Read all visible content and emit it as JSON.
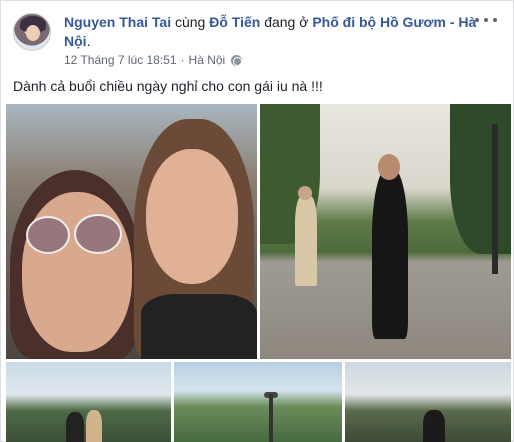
{
  "post": {
    "author": "Nguyen Thai Tai",
    "with_text": " cùng ",
    "tagged": "Đỗ Tiến",
    "at_text": " đang ở ",
    "place": "Phố đi bộ Hồ Gươm - Hà Nội",
    "place_suffix": ".",
    "timestamp": "12 Tháng 7 lúc 18:51",
    "separator": " · ",
    "location": "Hà Nội",
    "privacy_icon": "globe-icon",
    "menu_icon": "more-icon",
    "caption": "Dành cả buổi chiều ngày nghỉ cho con gái iu nà !!!"
  },
  "photos": [
    {
      "id": "photo-1",
      "subject": "selfie"
    },
    {
      "id": "photo-2",
      "subject": "lakeside"
    },
    {
      "id": "photo-3",
      "subject": "trees"
    },
    {
      "id": "photo-4",
      "subject": "trees"
    },
    {
      "id": "photo-5",
      "subject": "trees"
    }
  ],
  "colors": {
    "link": "#365899",
    "text": "#1d2129",
    "meta": "#616770",
    "border": "#dddfe2"
  }
}
